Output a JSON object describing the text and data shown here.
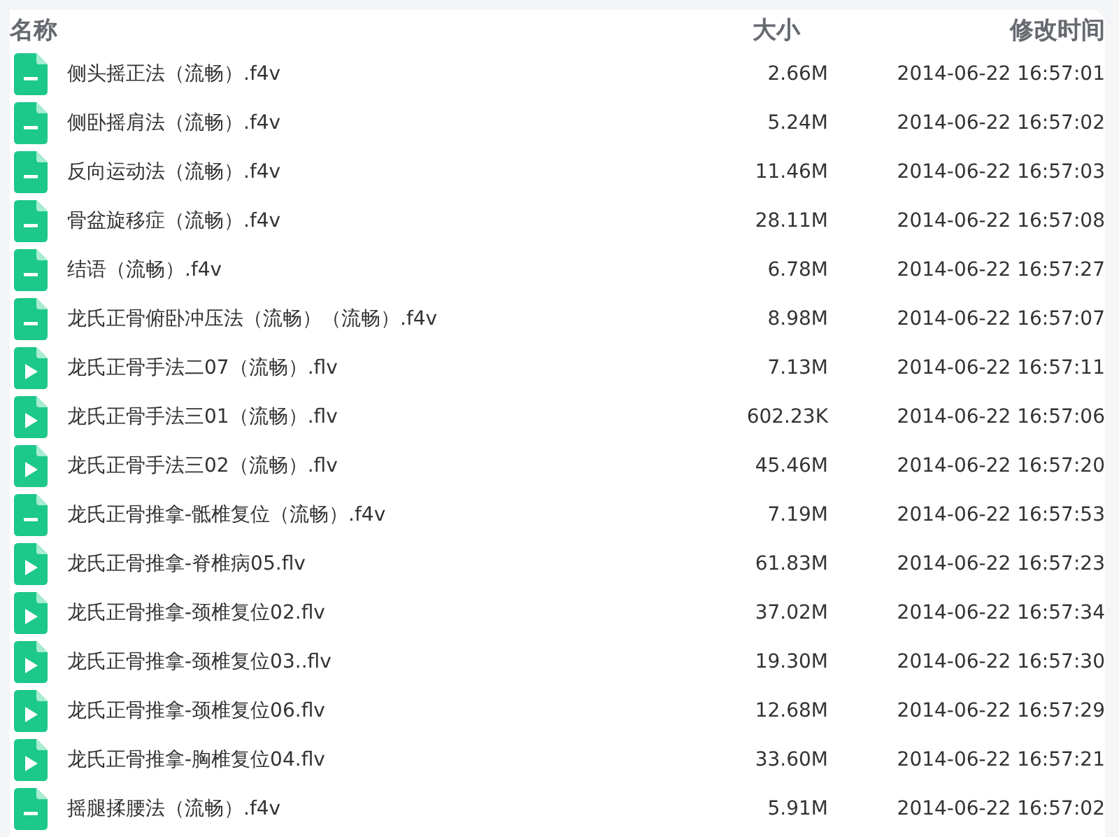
{
  "columns": [
    "名称",
    "大小",
    "修改时间"
  ],
  "files": [
    {
      "kind": "document",
      "name": "侧头摇正法（流畅）.f4v",
      "size": "2.66M",
      "modified": "2014-06-22 16:57:01"
    },
    {
      "kind": "document",
      "name": "侧卧摇肩法（流畅）.f4v",
      "size": "5.24M",
      "modified": "2014-06-22 16:57:02"
    },
    {
      "kind": "document",
      "name": "反向运动法（流畅）.f4v",
      "size": "11.46M",
      "modified": "2014-06-22 16:57:03"
    },
    {
      "kind": "document",
      "name": "骨盆旋移症（流畅）.f4v",
      "size": "28.11M",
      "modified": "2014-06-22 16:57:08"
    },
    {
      "kind": "document",
      "name": "结语（流畅）.f4v",
      "size": "6.78M",
      "modified": "2014-06-22 16:57:27"
    },
    {
      "kind": "document",
      "name": "龙氏正骨俯卧冲压法（流畅）（流畅）.f4v",
      "size": "8.98M",
      "modified": "2014-06-22 16:57:07"
    },
    {
      "kind": "video",
      "name": "龙氏正骨手法二07（流畅）.flv",
      "size": "7.13M",
      "modified": "2014-06-22 16:57:11"
    },
    {
      "kind": "video",
      "name": "龙氏正骨手法三01（流畅）.flv",
      "size": "602.23K",
      "modified": "2014-06-22 16:57:06"
    },
    {
      "kind": "video",
      "name": "龙氏正骨手法三02（流畅）.flv",
      "size": "45.46M",
      "modified": "2014-06-22 16:57:20"
    },
    {
      "kind": "document",
      "name": "龙氏正骨推拿-骶椎复位（流畅）.f4v",
      "size": "7.19M",
      "modified": "2014-06-22 16:57:53"
    },
    {
      "kind": "video",
      "name": "龙氏正骨推拿-脊椎病05.flv",
      "size": "61.83M",
      "modified": "2014-06-22 16:57:23"
    },
    {
      "kind": "video",
      "name": "龙氏正骨推拿-颈椎复位02.flv",
      "size": "37.02M",
      "modified": "2014-06-22 16:57:34"
    },
    {
      "kind": "video",
      "name": "龙氏正骨推拿-颈椎复位03..flv",
      "size": "19.30M",
      "modified": "2014-06-22 16:57:30"
    },
    {
      "kind": "video",
      "name": "龙氏正骨推拿-颈椎复位06.flv",
      "size": "12.68M",
      "modified": "2014-06-22 16:57:29"
    },
    {
      "kind": "video",
      "name": "龙氏正骨推拿-胸椎复位04.flv",
      "size": "33.60M",
      "modified": "2014-06-22 16:57:21"
    },
    {
      "kind": "document",
      "name": "摇腿揉腰法（流畅）.f4v",
      "size": "5.91M",
      "modified": "2014-06-22 16:57:02"
    }
  ]
}
